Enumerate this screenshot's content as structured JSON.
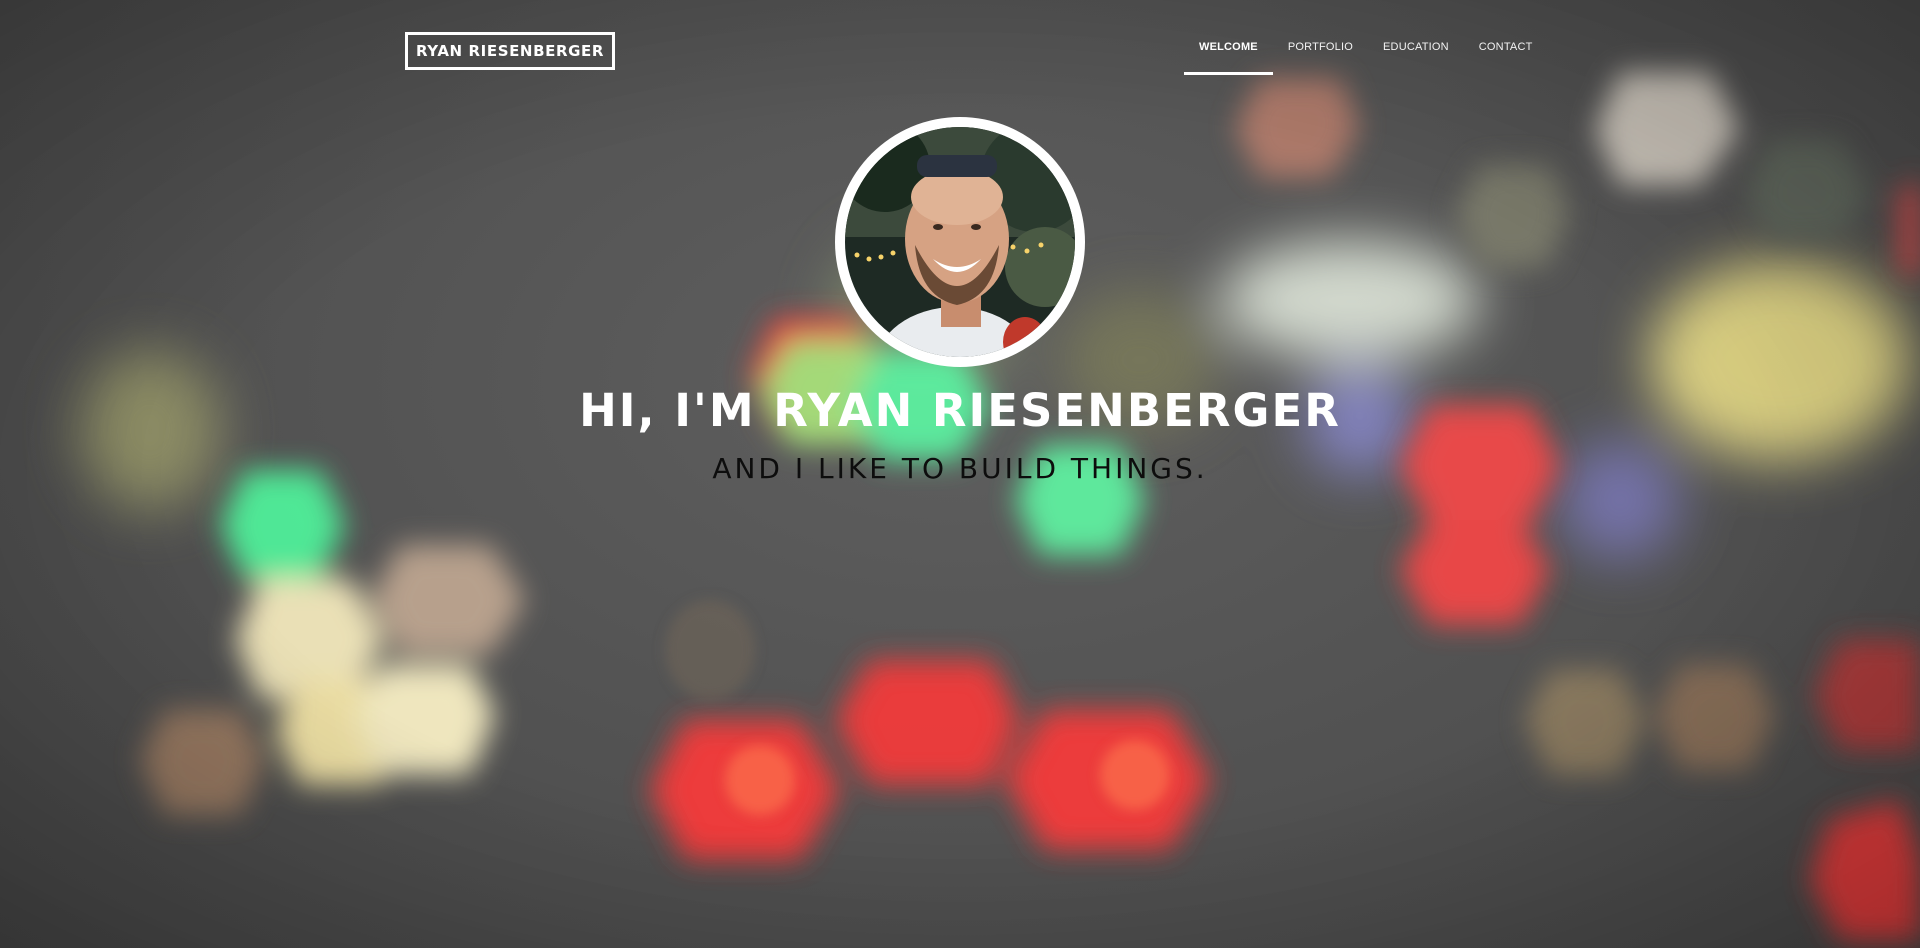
{
  "site": {
    "logo_text": "RYAN RIESENBERGER"
  },
  "nav": {
    "items": [
      {
        "label": "WELCOME",
        "active": true
      },
      {
        "label": "PORTFOLIO",
        "active": false
      },
      {
        "label": "EDUCATION",
        "active": false
      },
      {
        "label": "CONTACT",
        "active": false
      }
    ]
  },
  "hero": {
    "title": "HI, I'M RYAN RIESENBERGER",
    "subtitle": "AND I LIKE TO BUILD THINGS.",
    "avatar_icon": "profile-photo"
  },
  "colors": {
    "background": "#4f4f4f",
    "text_primary": "#ffffff",
    "subtitle": "#0d0d0d"
  }
}
